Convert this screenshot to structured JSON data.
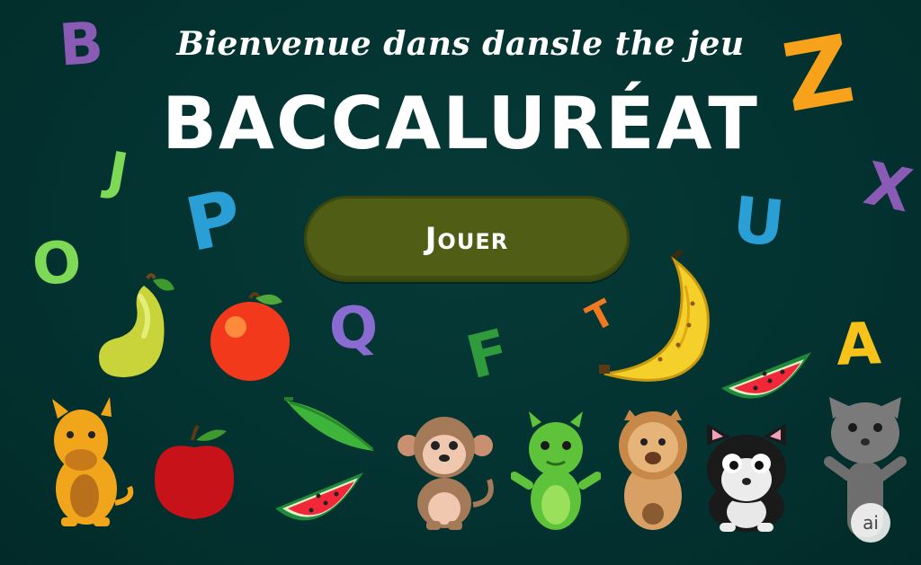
{
  "screen": {
    "subtitle": "Bienvenue dans dansle the jeu",
    "title": "BACCALURÉAT",
    "play_button_label": "Jouer",
    "badge_text": "ai"
  },
  "floating_letters": [
    {
      "char": "B",
      "color": "#8a5bb5"
    },
    {
      "char": "J",
      "color": "#7ed957"
    },
    {
      "char": "O",
      "color": "#7ed957"
    },
    {
      "char": "P",
      "color": "#2a9fd6"
    },
    {
      "char": "Q",
      "color": "#8a6bd1"
    },
    {
      "char": "F",
      "color": "#2f9b3a"
    },
    {
      "char": "T",
      "color": "#f0781e"
    },
    {
      "char": "U",
      "color": "#2a9fd6"
    },
    {
      "char": "Z",
      "color": "#f7a21a"
    },
    {
      "char": "X",
      "color": "#8a5bb5"
    },
    {
      "char": "A",
      "color": "#f7c21a"
    }
  ],
  "fruits": [
    "pear-icon",
    "orange-icon",
    "apple-icon",
    "pea-pod-icon",
    "watermelon-slice-icon",
    "banana-icon",
    "watermelon-slice-icon"
  ],
  "animals": [
    "yellow-horse-icon",
    "monkey-icon",
    "green-dragon-icon",
    "lion-icon",
    "black-white-cat-icon",
    "gray-cat-icon"
  ],
  "colors": {
    "background": "#033230",
    "button": "#4f5e14",
    "text": "#ffffff"
  }
}
